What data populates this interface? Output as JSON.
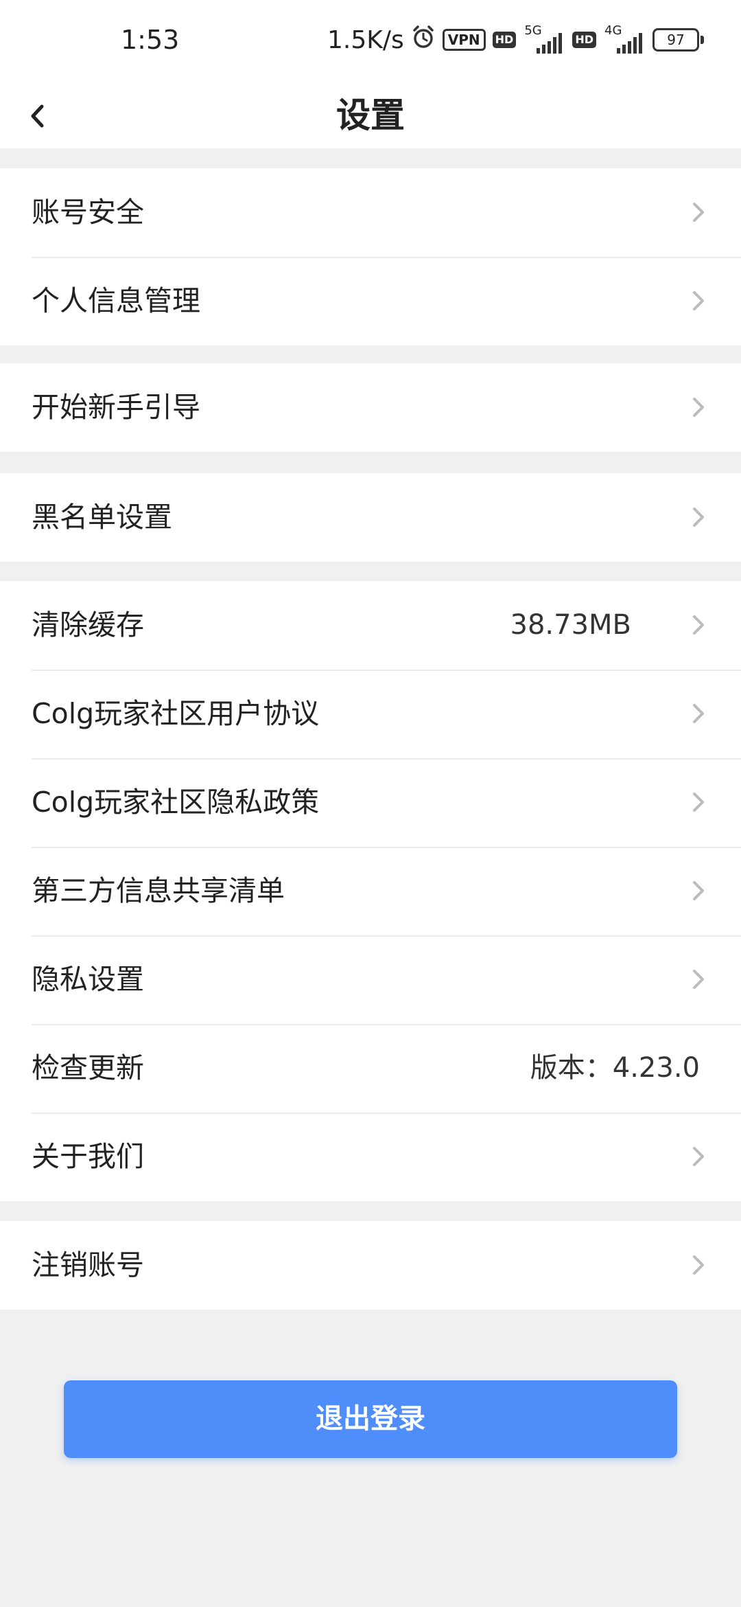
{
  "status_bar": {
    "time": "1:53",
    "net_speed": "1.5K/s",
    "vpn_label": "VPN",
    "hd_label": "HD",
    "network_1": "5G",
    "network_2": "4G",
    "battery": "97",
    "icons": [
      "alarm-icon",
      "vpn-icon",
      "hd-icon",
      "signal-icon",
      "battery-icon"
    ]
  },
  "header": {
    "title": "设置",
    "back_icon": "chevron-left-icon"
  },
  "groups": [
    {
      "items": [
        {
          "label": "账号安全",
          "chevron": true
        },
        {
          "label": "个人信息管理",
          "chevron": true
        }
      ]
    },
    {
      "items": [
        {
          "label": "开始新手引导",
          "chevron": true
        }
      ]
    },
    {
      "items": [
        {
          "label": "黑名单设置",
          "chevron": true
        }
      ]
    },
    {
      "items": [
        {
          "label": "清除缓存",
          "value": "38.73MB",
          "chevron": true
        },
        {
          "label": "Colg玩家社区用户协议",
          "chevron": true
        },
        {
          "label": "Colg玩家社区隐私政策",
          "chevron": true
        },
        {
          "label": "第三方信息共享清单",
          "chevron": true
        },
        {
          "label": "隐私设置",
          "chevron": true
        },
        {
          "label": "检查更新",
          "value": "版本：4.23.0",
          "chevron": false
        },
        {
          "label": "关于我们",
          "chevron": true
        }
      ]
    },
    {
      "items": [
        {
          "label": "注销账号",
          "chevron": true
        }
      ]
    }
  ],
  "logout_button": {
    "label": "退出登录"
  },
  "colors": {
    "background": "#f0f0f0",
    "primary": "#4f8efa",
    "chevron": "#bbbbbb",
    "divider": "#ececec"
  }
}
